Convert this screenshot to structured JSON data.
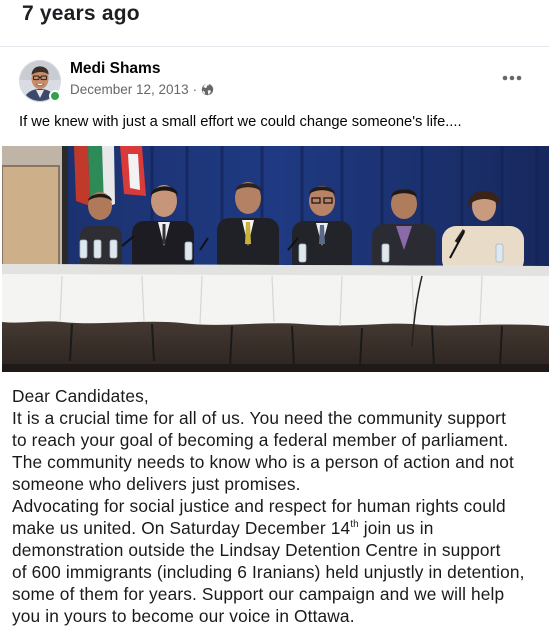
{
  "memory": {
    "title": "7 years ago"
  },
  "post": {
    "author": "Medi Shams",
    "date": "December 12, 2013",
    "meta_separator": "·",
    "audience_icon": "globe-icon",
    "more_icon": "more-options-icon",
    "text": "If we knew with just a small effort we could change someone's life....",
    "online_status_color": "#31a24c"
  },
  "image": {
    "description_icon": "panel-photo",
    "letter": {
      "line1": "Dear Candidates,",
      "line2": "It is a crucial time for all of us. You need the community support",
      "line3": "to reach your goal of becoming a federal member of parliament.",
      "line4": "The community needs to know who is a person of action and not",
      "line5": "someone who delivers just promises.",
      "line6": "Advocating for social justice and respect for human rights could",
      "line7a": "make us united. On Saturday December 14",
      "line7sup": "th",
      "line7b": " join us in",
      "line8": "demonstration outside the Lindsay Detention Centre in support",
      "line9": "of 600 immigrants (including 6 Iranians) held unjustly in detention,",
      "line10": "some of them for years.  Support our campaign and we will help",
      "line11": "you in yours to become our voice in Ottawa."
    }
  }
}
